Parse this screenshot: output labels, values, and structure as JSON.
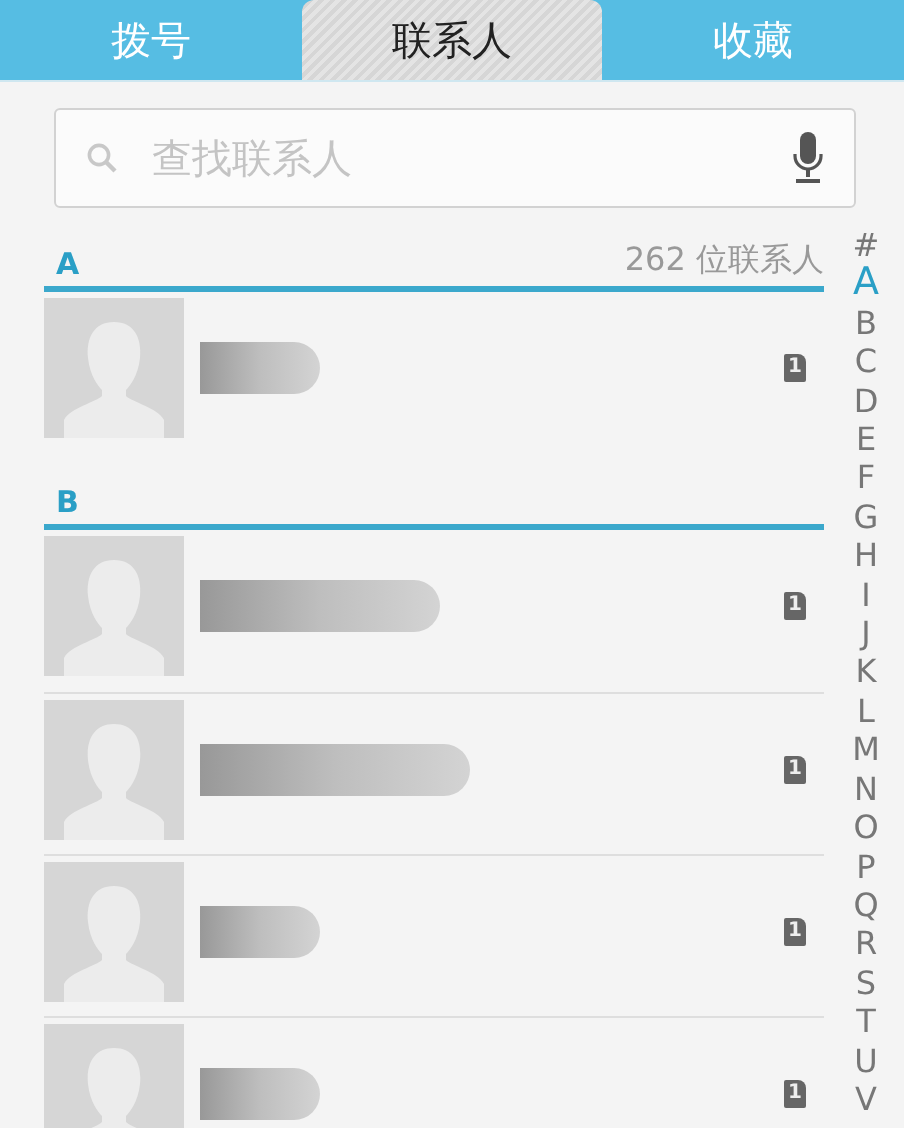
{
  "tabs": [
    {
      "label": "拨号",
      "selected": false
    },
    {
      "label": "联系人",
      "selected": true
    },
    {
      "label": "收藏",
      "selected": false
    }
  ],
  "search": {
    "placeholder": "查找联系人"
  },
  "sections": [
    {
      "letter": "A",
      "count": "262 位联系人",
      "contacts": [
        {
          "name_redacted": true,
          "sim": "1"
        }
      ]
    },
    {
      "letter": "B",
      "contacts": [
        {
          "name_redacted": true,
          "sim": "1"
        },
        {
          "name_redacted": true,
          "sim": "1"
        },
        {
          "name_redacted": true,
          "sim": "1"
        },
        {
          "name_redacted": true,
          "sim": "1"
        }
      ]
    }
  ],
  "index": [
    {
      "label": "#",
      "selected": false
    },
    {
      "label": "A",
      "selected": true
    },
    {
      "label": "B",
      "selected": false
    },
    {
      "label": "C",
      "selected": false
    },
    {
      "label": "D",
      "selected": false
    },
    {
      "label": "E",
      "selected": false
    },
    {
      "label": "F",
      "selected": false
    },
    {
      "label": "G",
      "selected": false
    },
    {
      "label": "H",
      "selected": false
    },
    {
      "label": "I",
      "selected": false
    },
    {
      "label": "J",
      "selected": false
    },
    {
      "label": "K",
      "selected": false
    },
    {
      "label": "L",
      "selected": false
    },
    {
      "label": "M",
      "selected": false
    },
    {
      "label": "N",
      "selected": false
    },
    {
      "label": "O",
      "selected": false
    },
    {
      "label": "P",
      "selected": false
    },
    {
      "label": "Q",
      "selected": false
    },
    {
      "label": "R",
      "selected": false
    },
    {
      "label": "S",
      "selected": false
    },
    {
      "label": "T",
      "selected": false
    },
    {
      "label": "U",
      "selected": false
    },
    {
      "label": "V",
      "selected": false
    }
  ]
}
